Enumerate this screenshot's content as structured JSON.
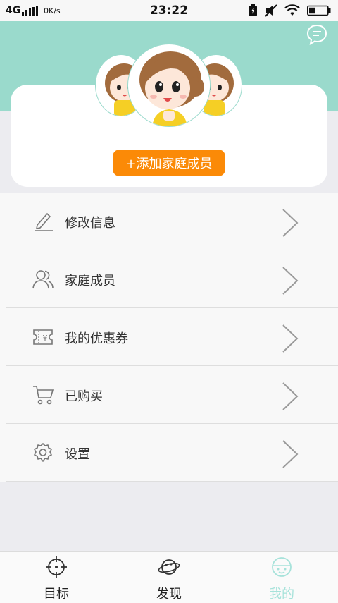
{
  "status_bar": {
    "network": "4G",
    "speed": "0K/s",
    "time": "23:22"
  },
  "header": {
    "message_icon": "chat-bubble-icon"
  },
  "profile": {
    "add_member_button": "+添加家庭成员"
  },
  "menu": {
    "items": [
      {
        "label": "修改信息",
        "icon": "edit-icon"
      },
      {
        "label": "家庭成员",
        "icon": "family-icon"
      },
      {
        "label": "我的优惠券",
        "icon": "coupon-icon"
      },
      {
        "label": "已购买",
        "icon": "cart-icon"
      },
      {
        "label": "设置",
        "icon": "gear-icon"
      }
    ]
  },
  "bottom_nav": {
    "tabs": [
      {
        "label": "目标",
        "icon": "target-icon",
        "active": false
      },
      {
        "label": "发现",
        "icon": "planet-icon",
        "active": false
      },
      {
        "label": "我的",
        "icon": "face-icon",
        "active": true
      }
    ]
  },
  "colors": {
    "accent_teal": "#9adacc",
    "button_orange": "#fb8a07",
    "active_tab": "#a6e2da"
  }
}
